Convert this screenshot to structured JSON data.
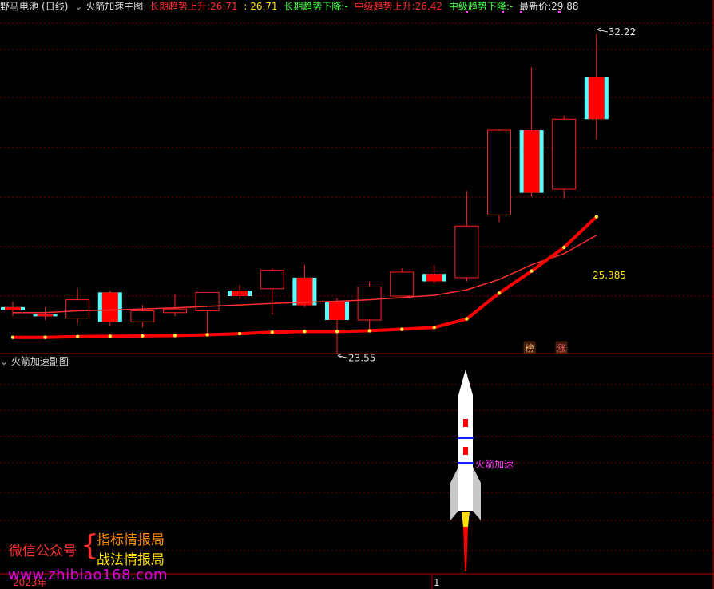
{
  "header": {
    "stock_name": "野马电池",
    "period": "(日线)",
    "indicator_main": "火箭加速主图",
    "long_up_label": "长期趋势上升:",
    "long_up_value": "26.71",
    "long_up_value2": ": 26.71",
    "long_down_label": "长期趋势下降:",
    "long_down_value": "-",
    "mid_up_label": "中级趋势上升:",
    "mid_up_value": "26.42",
    "mid_down_label": "中级趋势下降:",
    "mid_down_value": "-",
    "latest_label": "最新价:",
    "latest_value": "29.88"
  },
  "sub_panel": {
    "title": "火箭加速副图",
    "rocket_label": "火箭加速"
  },
  "watermark": {
    "wechat": "微信公众号",
    "line1": "指标情报局",
    "line2": "战法情报局",
    "url": "www.zhibiao168.com"
  },
  "bottom_axis": {
    "year": "2023年",
    "marker": "1"
  },
  "badges": [
    "榜",
    "涨"
  ],
  "colors": {
    "up": "#ff2020",
    "down_fill": "#ff0000",
    "cyan": "#55ffff",
    "ma_thin": "#ff3030",
    "ma_thick": "#ff0000",
    "dot": "#ffe840",
    "grid": "#7a0000",
    "label_white": "#e0e0e0",
    "label_yellow": "#ffe000",
    "label_green": "#40ff40",
    "label_red": "#ff3030",
    "label_magenta": "#ff40ff"
  },
  "chart_data": {
    "type": "candlestick",
    "ylim": [
      23.0,
      33.0
    ],
    "annotations": [
      {
        "text": "32.22",
        "kind": "high"
      },
      {
        "text": "23.55",
        "kind": "low"
      },
      {
        "text": "25.385",
        "kind": "value"
      }
    ],
    "candles": [
      {
        "o": 24.8,
        "h": 24.95,
        "l": 24.55,
        "c": 24.72,
        "style": "red_cyan_edge"
      },
      {
        "o": 24.6,
        "h": 24.8,
        "l": 24.45,
        "c": 24.55,
        "style": "red_cyan_edge"
      },
      {
        "o": 24.5,
        "h": 25.3,
        "l": 24.35,
        "c": 25.0,
        "style": "hollow"
      },
      {
        "o": 25.2,
        "h": 25.25,
        "l": 24.3,
        "c": 24.4,
        "style": "red_cyan_edge"
      },
      {
        "o": 24.4,
        "h": 24.85,
        "l": 24.25,
        "c": 24.7,
        "style": "hollow"
      },
      {
        "o": 24.65,
        "h": 25.15,
        "l": 24.55,
        "c": 24.75,
        "style": "hollow"
      },
      {
        "o": 24.7,
        "h": 25.2,
        "l": 24.1,
        "c": 25.2,
        "style": "hollow"
      },
      {
        "o": 25.25,
        "h": 25.4,
        "l": 25.0,
        "c": 25.1,
        "style": "red_cyan_edge"
      },
      {
        "o": 25.3,
        "h": 25.85,
        "l": 24.6,
        "c": 25.8,
        "style": "hollow"
      },
      {
        "o": 25.6,
        "h": 25.95,
        "l": 24.8,
        "c": 24.85,
        "style": "red_cyan_edge"
      },
      {
        "o": 24.95,
        "h": 25.05,
        "l": 23.55,
        "c": 24.45,
        "style": "red_cyan_edge"
      },
      {
        "o": 24.45,
        "h": 25.5,
        "l": 24.2,
        "c": 25.35,
        "style": "hollow"
      },
      {
        "o": 25.1,
        "h": 25.85,
        "l": 25.1,
        "c": 25.75,
        "style": "hollow"
      },
      {
        "o": 25.7,
        "h": 25.95,
        "l": 25.45,
        "c": 25.5,
        "style": "red_cyan_edge"
      },
      {
        "o": 25.6,
        "h": 27.95,
        "l": 25.5,
        "c": 27.0,
        "style": "hollow"
      },
      {
        "o": 27.3,
        "h": 29.62,
        "l": 27.1,
        "c": 29.6,
        "style": "hollow"
      },
      {
        "o": 29.6,
        "h": 31.3,
        "l": 27.8,
        "c": 27.9,
        "style": "red_cyan_edge"
      },
      {
        "o": 28.0,
        "h": 30.0,
        "l": 27.75,
        "c": 29.9,
        "style": "hollow"
      },
      {
        "o": 31.05,
        "h": 32.22,
        "l": 29.35,
        "c": 29.9,
        "style": "red_cyan_edge"
      }
    ],
    "ma_thin": [
      24.65,
      24.65,
      24.7,
      24.72,
      24.75,
      24.78,
      24.82,
      24.86,
      24.9,
      24.93,
      24.96,
      25.0,
      25.06,
      25.12,
      25.27,
      25.55,
      25.95,
      26.25,
      26.75
    ],
    "ma_thick": [
      23.98,
      23.98,
      24.0,
      24.01,
      24.02,
      24.03,
      24.05,
      24.08,
      24.12,
      24.14,
      24.14,
      24.16,
      24.2,
      24.25,
      24.48,
      25.18,
      25.78,
      26.42,
      27.25
    ]
  }
}
